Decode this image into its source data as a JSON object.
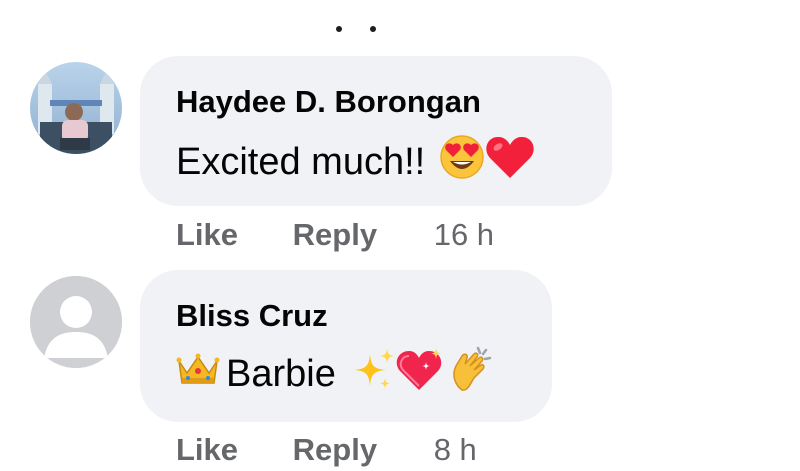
{
  "comments": [
    {
      "author": "Haydee D. Borongan",
      "text": "Excited much!!",
      "emojis": [
        "heart-eyes-emoji",
        "red-heart-emoji"
      ],
      "actions": {
        "like": "Like",
        "reply": "Reply",
        "time": "16 h"
      },
      "avatar": "profile-photo"
    },
    {
      "author": "Bliss Cruz",
      "text_prefix_emoji": "crown-emoji",
      "text": "Barbie",
      "emojis": [
        "sparkles-emoji",
        "sparkling-heart-emoji",
        "clapping-hands-emoji"
      ],
      "actions": {
        "like": "Like",
        "reply": "Reply",
        "time": "8 h"
      },
      "avatar": "default-avatar"
    }
  ],
  "colors": {
    "bubble": "#f0f2f5",
    "meta_text": "#65676b",
    "text": "#050505"
  }
}
